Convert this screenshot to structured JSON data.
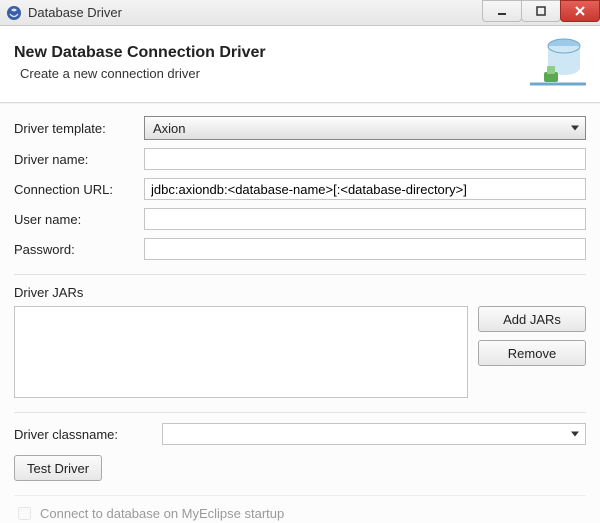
{
  "window": {
    "title": "Database Driver"
  },
  "header": {
    "title": "New Database Connection Driver",
    "subtitle": "Create a new connection driver"
  },
  "labels": {
    "driverTemplate": "Driver template:",
    "driverName": "Driver name:",
    "connectionUrl": "Connection URL:",
    "userName": "User name:",
    "password": "Password:",
    "driverJars": "Driver JARs",
    "driverClassname": "Driver classname:"
  },
  "fields": {
    "driverTemplate": "Axion",
    "driverName": "",
    "connectionUrl": "jdbc:axiondb:<database-name>[:<database-directory>]",
    "userName": "",
    "password": "",
    "driverClassname": ""
  },
  "buttons": {
    "addJars": "Add JARs",
    "remove": "Remove",
    "testDriver": "Test Driver"
  },
  "checkbox": {
    "connectStartup": "Connect to database on MyEclipse startup"
  }
}
